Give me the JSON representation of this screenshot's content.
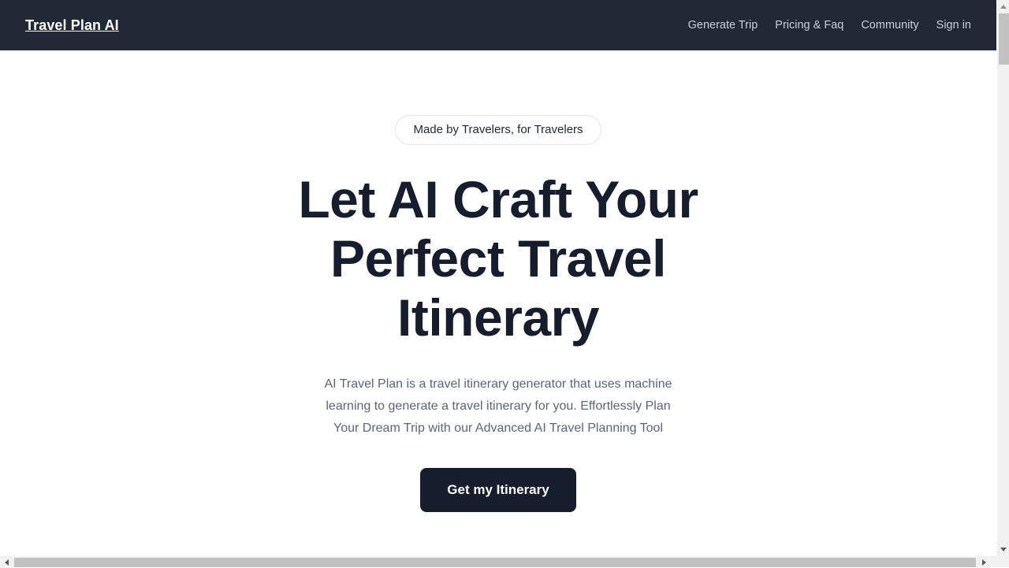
{
  "page": {
    "background_color": "#ffffff"
  },
  "navbar": {
    "background_color": "#212936",
    "brand": "Travel Plan AI",
    "links": [
      {
        "label": "Generate Trip"
      },
      {
        "label": "Pricing & Faq"
      },
      {
        "label": "Community"
      },
      {
        "label": "Sign in"
      }
    ]
  },
  "hero": {
    "badge": "Made by Travelers, for Travelers",
    "title": "Let AI Craft Your Perfect Travel Itinerary",
    "title_color": "#161d2d",
    "subtitle": "AI Travel Plan is a travel itinerary generator that uses machine learning to generate a travel itinerary for you. Effortlessly Plan Your Dream Trip with our Advanced AI Travel Planning Tool",
    "subtitle_color": "#5a6577",
    "cta_label": "Get my Itinerary",
    "cta_background_color": "#161d2d",
    "cta_text_color": "#ffffff"
  },
  "scrollbars": {
    "vertical": {
      "up_icon": "scroll-up-arrow-icon",
      "down_icon": "scroll-down-arrow-icon",
      "thumb_color": "#c1c1c1",
      "track_color": "#f1f1f1"
    },
    "horizontal": {
      "left_icon": "scroll-left-arrow-icon",
      "right_icon": "scroll-right-arrow-icon",
      "thumb_color": "#c1c1c1",
      "track_color": "#f1f1f1"
    }
  }
}
